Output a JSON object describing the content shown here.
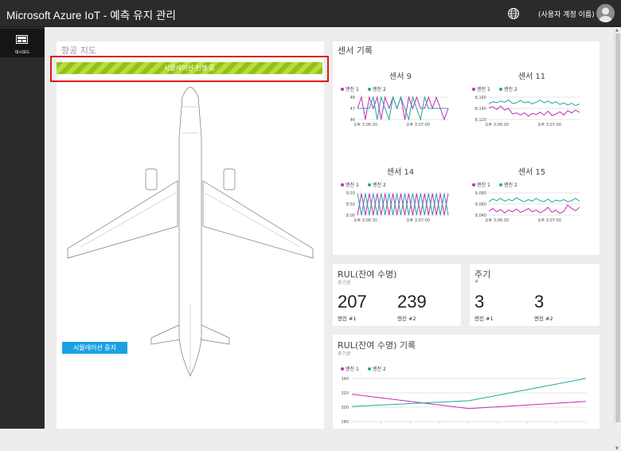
{
  "header": {
    "title": "Microsoft Azure IoT - 예측 유지 관리",
    "account_label": "(사용자 계정 이름)",
    "icons": [
      "globe-icon",
      "user-avatar-icon"
    ]
  },
  "sidebar": {
    "items": [
      {
        "label": "대시보드",
        "icon": "dashboard-icon"
      }
    ]
  },
  "flight_map": {
    "title": "항공 지도",
    "banner": "시뮬레이션 진행 중",
    "stop_button": "시뮬레이션 중지"
  },
  "sensor_log": {
    "title": "센서 기록",
    "legend": [
      "엔진 1",
      "엔진 2"
    ],
    "colors": {
      "engine1": "#c12bb8",
      "engine2": "#1ea89e"
    }
  },
  "rul": {
    "title": "RUL(잔여 수명)",
    "unit": "주기로",
    "engine1_value": "207",
    "engine1_label": "엔진 #1",
    "engine2_value": "239",
    "engine2_label": "엔진 #2"
  },
  "cycles": {
    "title": "주기",
    "unit": "#",
    "engine1_value": "3",
    "engine1_label": "엔진 #1",
    "engine2_value": "3",
    "engine2_label": "엔진 #2"
  },
  "rul_history": {
    "title": "RUL(잔여 수명) 기록",
    "unit": "주기로",
    "legend": [
      "엔진 1",
      "엔진 2"
    ]
  },
  "chart_data": [
    {
      "type": "line",
      "title": "센서 9",
      "ytick_labels": [
        "48",
        "47",
        "46"
      ],
      "ylim": [
        46,
        48
      ],
      "xtick_labels": [
        "오후 3:06:30",
        "오후 3:07:00"
      ],
      "series": [
        {
          "name": "엔진 1",
          "values": [
            47,
            48,
            46,
            48,
            47,
            48,
            46,
            48,
            47,
            48,
            47,
            48,
            46,
            48,
            47,
            48,
            47,
            47,
            48,
            47,
            48,
            47,
            46,
            47
          ]
        },
        {
          "name": "엔진 2",
          "values": [
            47,
            47,
            47,
            47,
            48,
            46,
            48,
            47,
            46,
            48,
            47,
            48,
            47,
            46,
            48,
            47,
            46,
            48,
            47,
            47,
            47,
            47,
            47,
            47
          ]
        }
      ]
    },
    {
      "type": "line",
      "title": "센서 11",
      "ytick_labels": [
        "8,160",
        "8,140",
        "8,120"
      ],
      "ylim": [
        8120,
        8160
      ],
      "xtick_labels": [
        "오후 3:06:30",
        "오후 3:07:00"
      ],
      "series": [
        {
          "name": "엔진 1",
          "values": [
            8141,
            8143,
            8138,
            8144,
            8137,
            8140,
            8130,
            8132,
            8128,
            8132,
            8126,
            8131,
            8129,
            8133,
            8128,
            8135,
            8127,
            8130,
            8134,
            8128,
            8136,
            8132,
            8137,
            8133
          ]
        },
        {
          "name": "엔진 2",
          "values": [
            8148,
            8152,
            8150,
            8153,
            8151,
            8155,
            8149,
            8150,
            8154,
            8150,
            8152,
            8148,
            8151,
            8155,
            8150,
            8153,
            8149,
            8152,
            8147,
            8150,
            8146,
            8149,
            8145,
            8148
          ]
        }
      ]
    },
    {
      "type": "line",
      "title": "센서 14",
      "ytick_labels": [
        "9.03",
        "8.50",
        "8.00"
      ],
      "ylim": [
        8.0,
        9.03
      ],
      "xtick_labels": [
        "오후 3:06:30",
        "오후 3:07:00"
      ],
      "series": [
        {
          "name": "엔진 1",
          "values": [
            8.0,
            9.0,
            8.0,
            9.0,
            8.0,
            9.0,
            8.0,
            9.0,
            8.0,
            9.0,
            8.0,
            9.0,
            8.0,
            9.0,
            8.0,
            9.0,
            8.0,
            9.0,
            8.0,
            9.0,
            8.0,
            9.0,
            8.0,
            9.0
          ]
        },
        {
          "name": "엔진 2",
          "values": [
            9.0,
            8.0,
            9.0,
            8.0,
            9.0,
            8.0,
            9.0,
            8.0,
            9.0,
            8.0,
            9.0,
            8.0,
            9.0,
            8.0,
            9.0,
            8.0,
            9.0,
            8.0,
            9.0,
            8.0,
            9.0,
            8.0,
            9.0,
            8.0
          ]
        }
      ]
    },
    {
      "type": "line",
      "title": "센서 15",
      "ytick_labels": [
        "9,080",
        "9,060",
        "9,040"
      ],
      "ylim": [
        9040,
        9080
      ],
      "xtick_labels": [
        "오후 3:06:30",
        "오후 3:07:00"
      ],
      "series": [
        {
          "name": "엔진 1",
          "values": [
            9047,
            9052,
            9046,
            9050,
            9044,
            9049,
            9046,
            9051,
            9045,
            9048,
            9052,
            9046,
            9049,
            9044,
            9048,
            9054,
            9045,
            9049,
            9043,
            9047,
            9058,
            9052,
            9048,
            9054
          ]
        },
        {
          "name": "엔진 2",
          "values": [
            9064,
            9069,
            9066,
            9070,
            9065,
            9068,
            9066,
            9071,
            9067,
            9064,
            9068,
            9065,
            9070,
            9066,
            9064,
            9069,
            9063,
            9067,
            9065,
            9068,
            9064,
            9066,
            9070,
            9065
          ]
        }
      ]
    },
    {
      "type": "line",
      "title": "",
      "ytick_labels": [
        "340",
        "320",
        "300",
        "180"
      ],
      "x": [
        1,
        2,
        3
      ],
      "series": [
        {
          "name": "엔진 1",
          "values": [
            318,
            298,
            308
          ]
        },
        {
          "name": "엔진 2",
          "values": [
            301,
            309,
            340
          ]
        }
      ]
    }
  ]
}
